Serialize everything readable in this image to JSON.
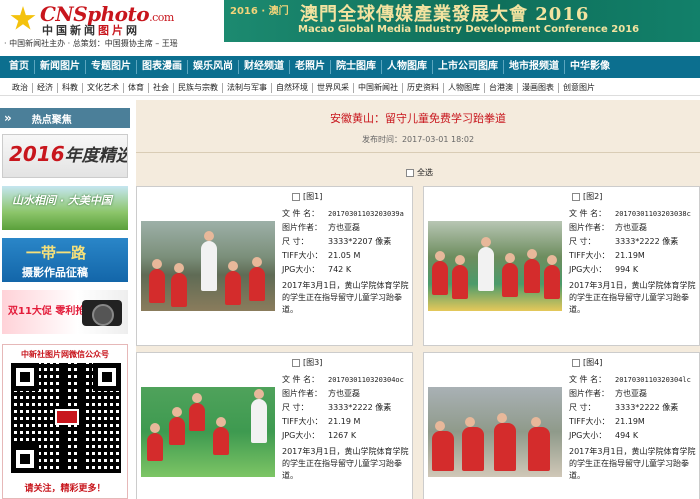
{
  "header": {
    "logo_text": "CNSphoto",
    "logo_suffix": ".com",
    "logo_sub_black": "中国新闻",
    "logo_sub_red": "图片",
    "logo_sub_end": "网",
    "sponsor": "· 中国新闻社主办 · 总策划：中国摄协主席 – 王瑶"
  },
  "banner": {
    "year": "2016 · 澳门",
    "title_cn": "澳門全球傳媒產業發展大會 2016",
    "title_en": "Macao Global Media Industry Development Conference 2016"
  },
  "nav": {
    "items": [
      "首页",
      "新闻图片",
      "专题图片",
      "图表漫画",
      "娱乐风尚",
      "财经频道",
      "老照片",
      "院士图库",
      "人物图库",
      "上市公司图库",
      "地市报频道",
      "中华影像"
    ]
  },
  "subnav": {
    "items": [
      "政治",
      "经济",
      "科教",
      "文化艺术",
      "体育",
      "社会",
      "民族与宗教",
      "法制与军事",
      "自然环境",
      "世界风采",
      "中国新闻社",
      "历史资料",
      "人物图库",
      "台港澳",
      "漫画图表",
      "创意图片"
    ]
  },
  "sidebar": {
    "head_arrow": "»",
    "head_title": "热点聚焦",
    "banner1_red": "2016",
    "banner1_black": "年度精选",
    "banner2_text": "山水相间 · 大美中国",
    "banner3_a": "一带一路",
    "banner3_b": "摄影作品征稿",
    "banner4_text": "双11大促 零利抢",
    "qr_title": "中新社图片网微信公众号",
    "qr_foot": "请关注，精彩更多！"
  },
  "article": {
    "title": "安徽黄山：留守儿童免费学习跆拳道",
    "pub_time": "发布时间：2017-03-01 18:02",
    "select_all": "全选"
  },
  "labels": {
    "filename": "文 件 名：",
    "author": "图片作者：",
    "size": "尺    寸：",
    "tiff": "TIFF大小：",
    "jpg": "JPG大小："
  },
  "photos": [
    {
      "index": "[图1]",
      "filename": "20170301103203039a",
      "author": "方也亚磊",
      "size": "3333*2207 像素",
      "tiff": "21.05 M",
      "jpg": "742  K",
      "desc": "2017年3月1日，黄山学院体育学院的学生正在指导留守儿童学习跆拳道。"
    },
    {
      "index": "[图2]",
      "filename": "20170301103203038c",
      "author": "方也亚磊",
      "size": "3333*2222 像素",
      "tiff": "21.19M",
      "jpg": "994  K",
      "desc": "2017年3月1日，黄山学院体育学院的学生正在指导留守儿童学习跆拳道。"
    },
    {
      "index": "[图3]",
      "filename": "2017030110320304oc",
      "author": "方也亚磊",
      "size": "3333*2222 像素",
      "tiff": "21.19 M",
      "jpg": "1267 K",
      "desc": "2017年3月1日，黄山学院体育学院的学生正在指导留守儿童学习跆拳道。"
    },
    {
      "index": "[图4]",
      "filename": "2017030110320304lc",
      "author": "方也亚磊",
      "size": "3333*2222 像素",
      "tiff": "21.19M",
      "jpg": "494  K",
      "desc": "2017年3月1日，黄山学院体育学院的学生正在指导留守儿童学习跆拳道。"
    }
  ]
}
